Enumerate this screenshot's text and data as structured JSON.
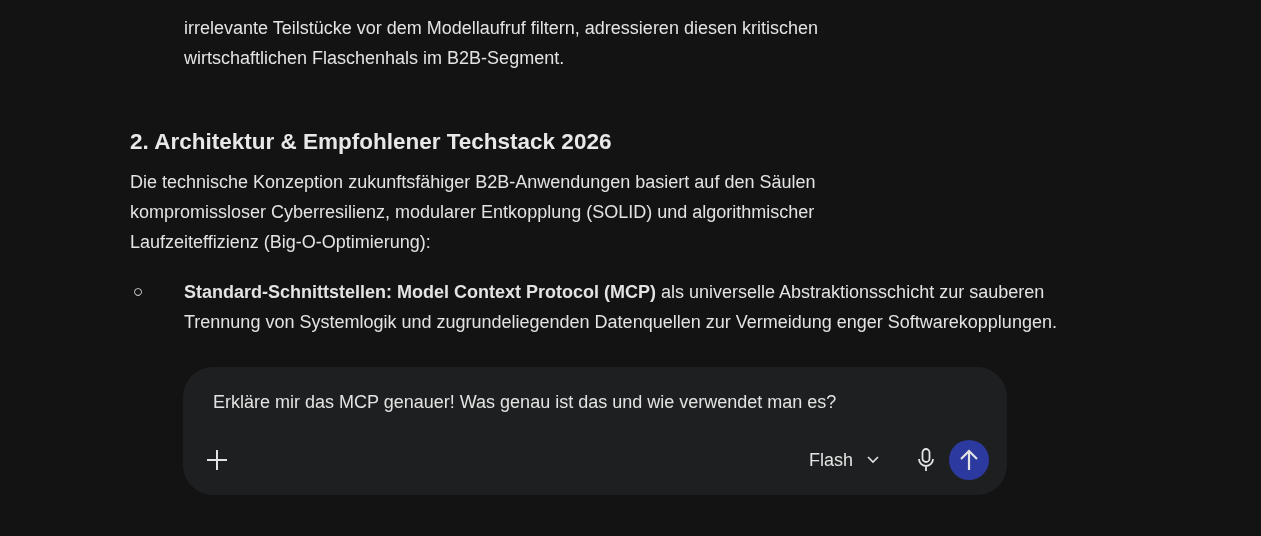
{
  "paragraphs_top": [
    "irrelevante Teilstücke vor dem Modellaufruf filtern, adressieren diesen kritischen wirtschaftlichen Flaschenhals im B2B-Segment."
  ],
  "section": {
    "heading": "2. Architektur & Empfohlener Techstack 2026",
    "intro": "Die technische Konzeption zukunftsfähiger B2B-Anwendungen basiert auf den Säulen kompromissloser Cyberresilienz, modularer Entkopplung (SOLID) und algorithmischer Laufzeiteffizienz (Big-O-Optimierung):",
    "bullets": [
      {
        "bullet": "○",
        "text": "**Standard-Schnittstellen: Model Context Protocol (MCP)** als universelle Abstraktionsschicht zur sauberen Trennung von Systemlogik und zugrundeliegenden Datenquellen zur Vermeidung enger Softwarekopplungen."
      }
    ]
  },
  "composer": {
    "value": "Erkläre mir das MCP genauer! Was genau ist das und wie verwendet man es?",
    "model": "Flash"
  }
}
